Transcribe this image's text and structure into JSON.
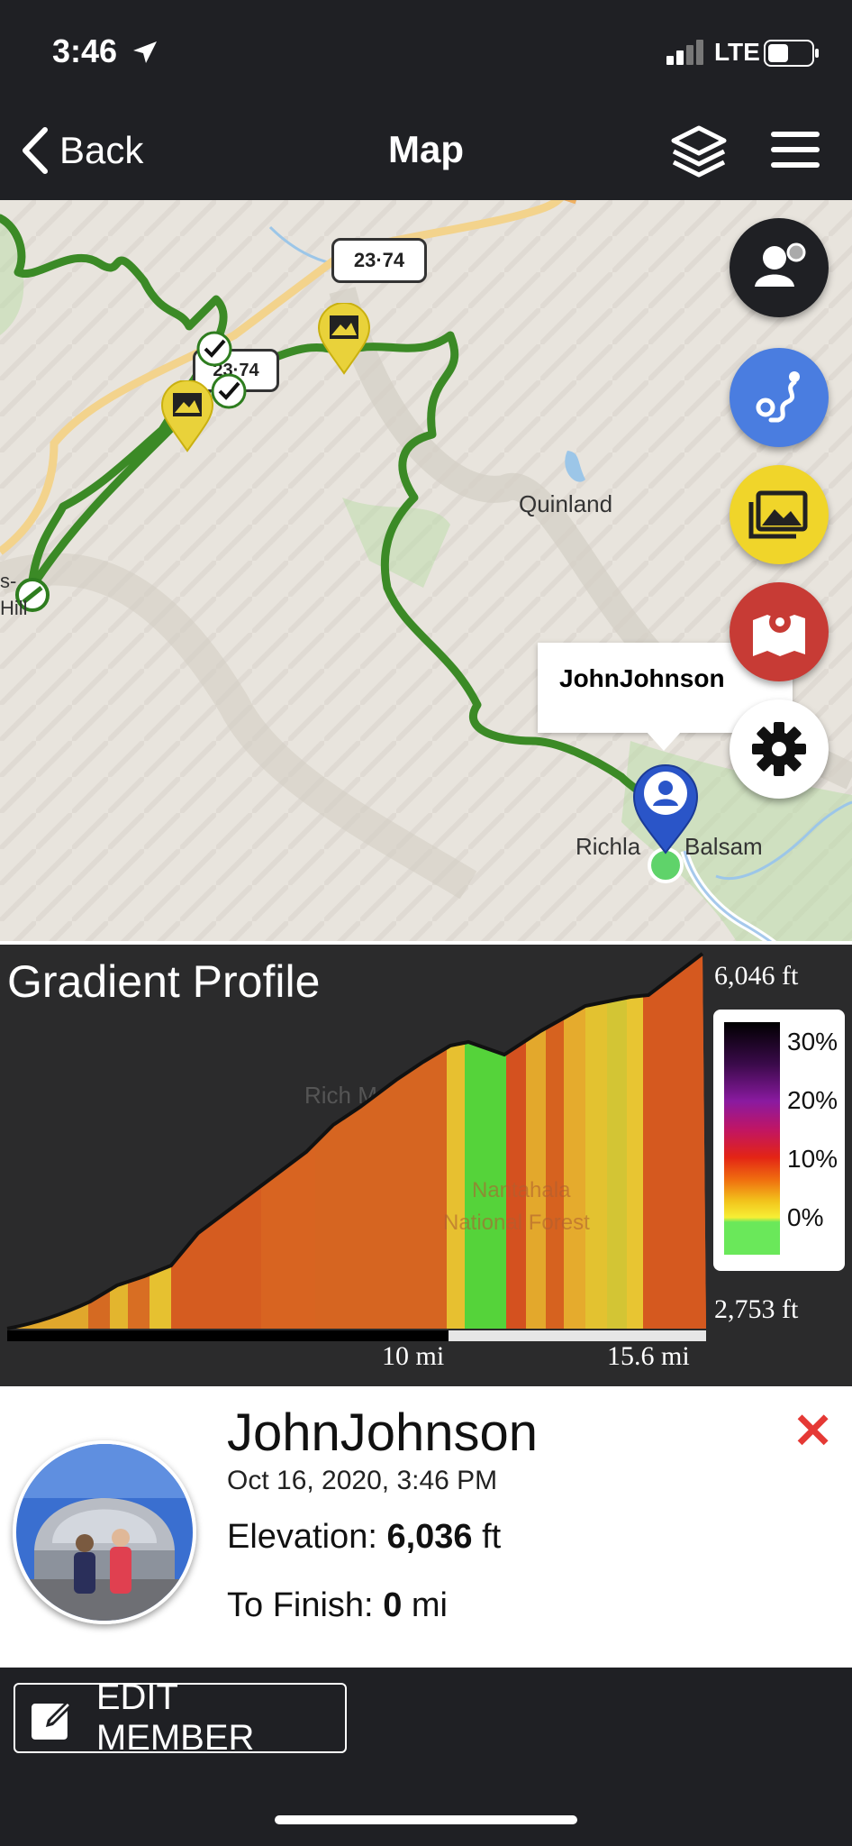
{
  "status": {
    "time": "3:46",
    "network": "LTE"
  },
  "nav": {
    "back_label": "Back",
    "title": "Map"
  },
  "map": {
    "callout_name": "JohnJohnson",
    "labels": {
      "quinland": "Quinland",
      "road_shield_1": "23·74",
      "road_shield_2": "23·74",
      "richland": "Richla",
      "balsam": "Balsam",
      "hill_1": "s-",
      "hill_2": "Hill"
    }
  },
  "profile": {
    "title": "Gradient Profile",
    "max_elev": "6,046 ft",
    "min_elev": "2,753 ft",
    "dist_mid": "10 mi",
    "dist_end": "15.6 mi",
    "legend": [
      "30%",
      "20%",
      "10%",
      "0%"
    ],
    "bg_labels": {
      "mountain": "Rich Mountain",
      "forest_1": "Nantahala",
      "forest_2": "National Forest"
    }
  },
  "member": {
    "name": "JohnJohnson",
    "date": "Oct 16, 2020, 3:46 PM",
    "elevation_label": "Elevation:",
    "elevation_value": "6,036",
    "elevation_unit": "ft",
    "finish_label": "To Finish:",
    "finish_value": "0",
    "finish_unit": "mi",
    "close_glyph": "✕"
  },
  "edit_button": "EDIT MEMBER",
  "colors": {
    "bar": "#1f2024",
    "route": "#2e7d1f",
    "blue_fab": "#4a7de0",
    "yellow_fab": "#f0d52a",
    "red_fab": "#c73b35",
    "close": "#e53935"
  }
}
